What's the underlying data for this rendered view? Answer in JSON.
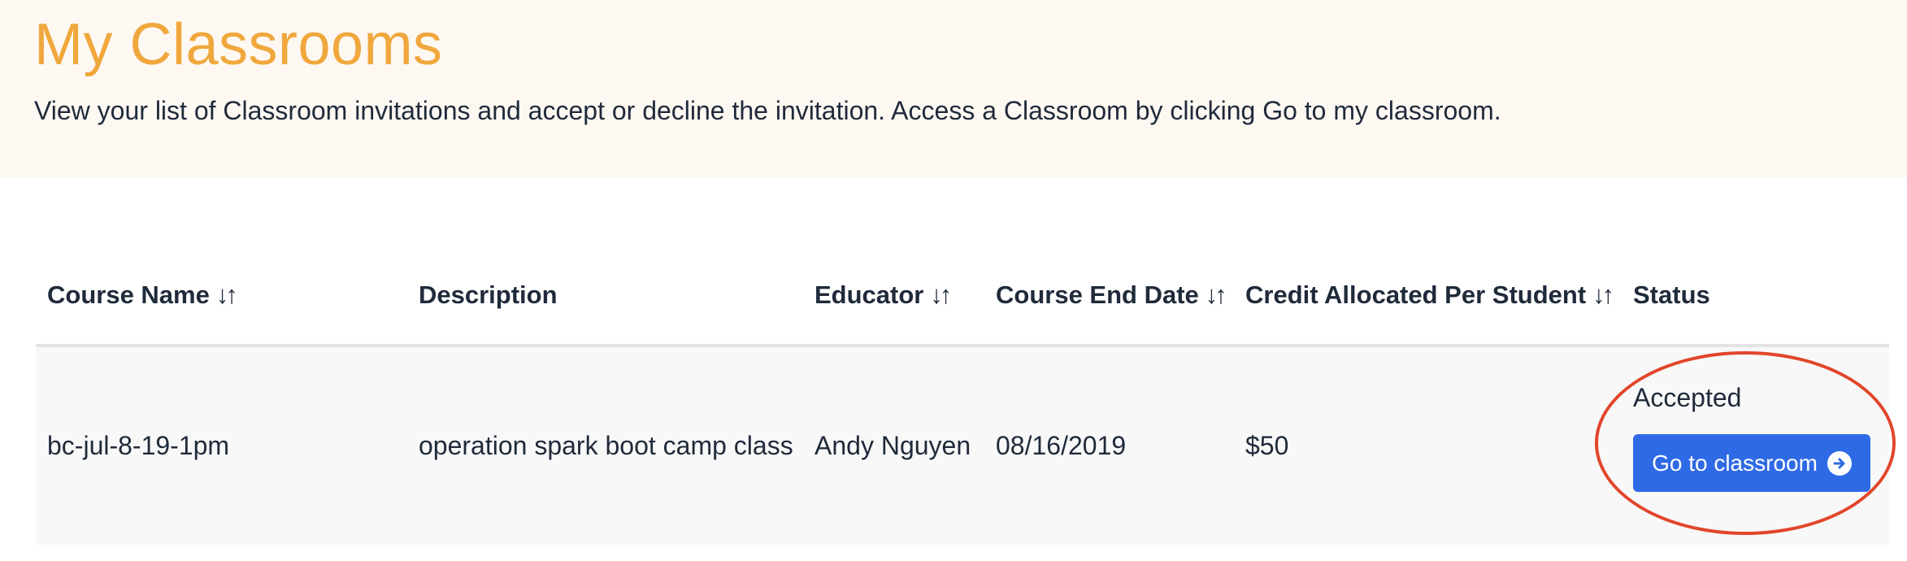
{
  "header": {
    "title": "My Classrooms",
    "description": "View your list of Classroom invitations and accept or decline the invitation. Access a Classroom by clicking Go to my classroom."
  },
  "table": {
    "columns": [
      {
        "label": "Course Name",
        "sortable": true
      },
      {
        "label": "Description",
        "sortable": false
      },
      {
        "label": "Educator",
        "sortable": true
      },
      {
        "label": "Course End Date",
        "sortable": true
      },
      {
        "label": "Credit Allocated Per Student",
        "sortable": true
      },
      {
        "label": "Status",
        "sortable": false
      }
    ],
    "sort_icon": "↓↑",
    "rows": [
      {
        "course_name": "bc-jul-8-19-1pm",
        "description": "operation spark boot camp class",
        "educator": "Andy Nguyen",
        "end_date": "08/16/2019",
        "credit": "$50",
        "status": "Accepted",
        "action_label": "Go to classroom"
      }
    ]
  },
  "colors": {
    "accent": "#f0a73c",
    "button": "#2f6ae6",
    "annotation": "#e2462b",
    "header_bg": "#fdf8f2"
  }
}
